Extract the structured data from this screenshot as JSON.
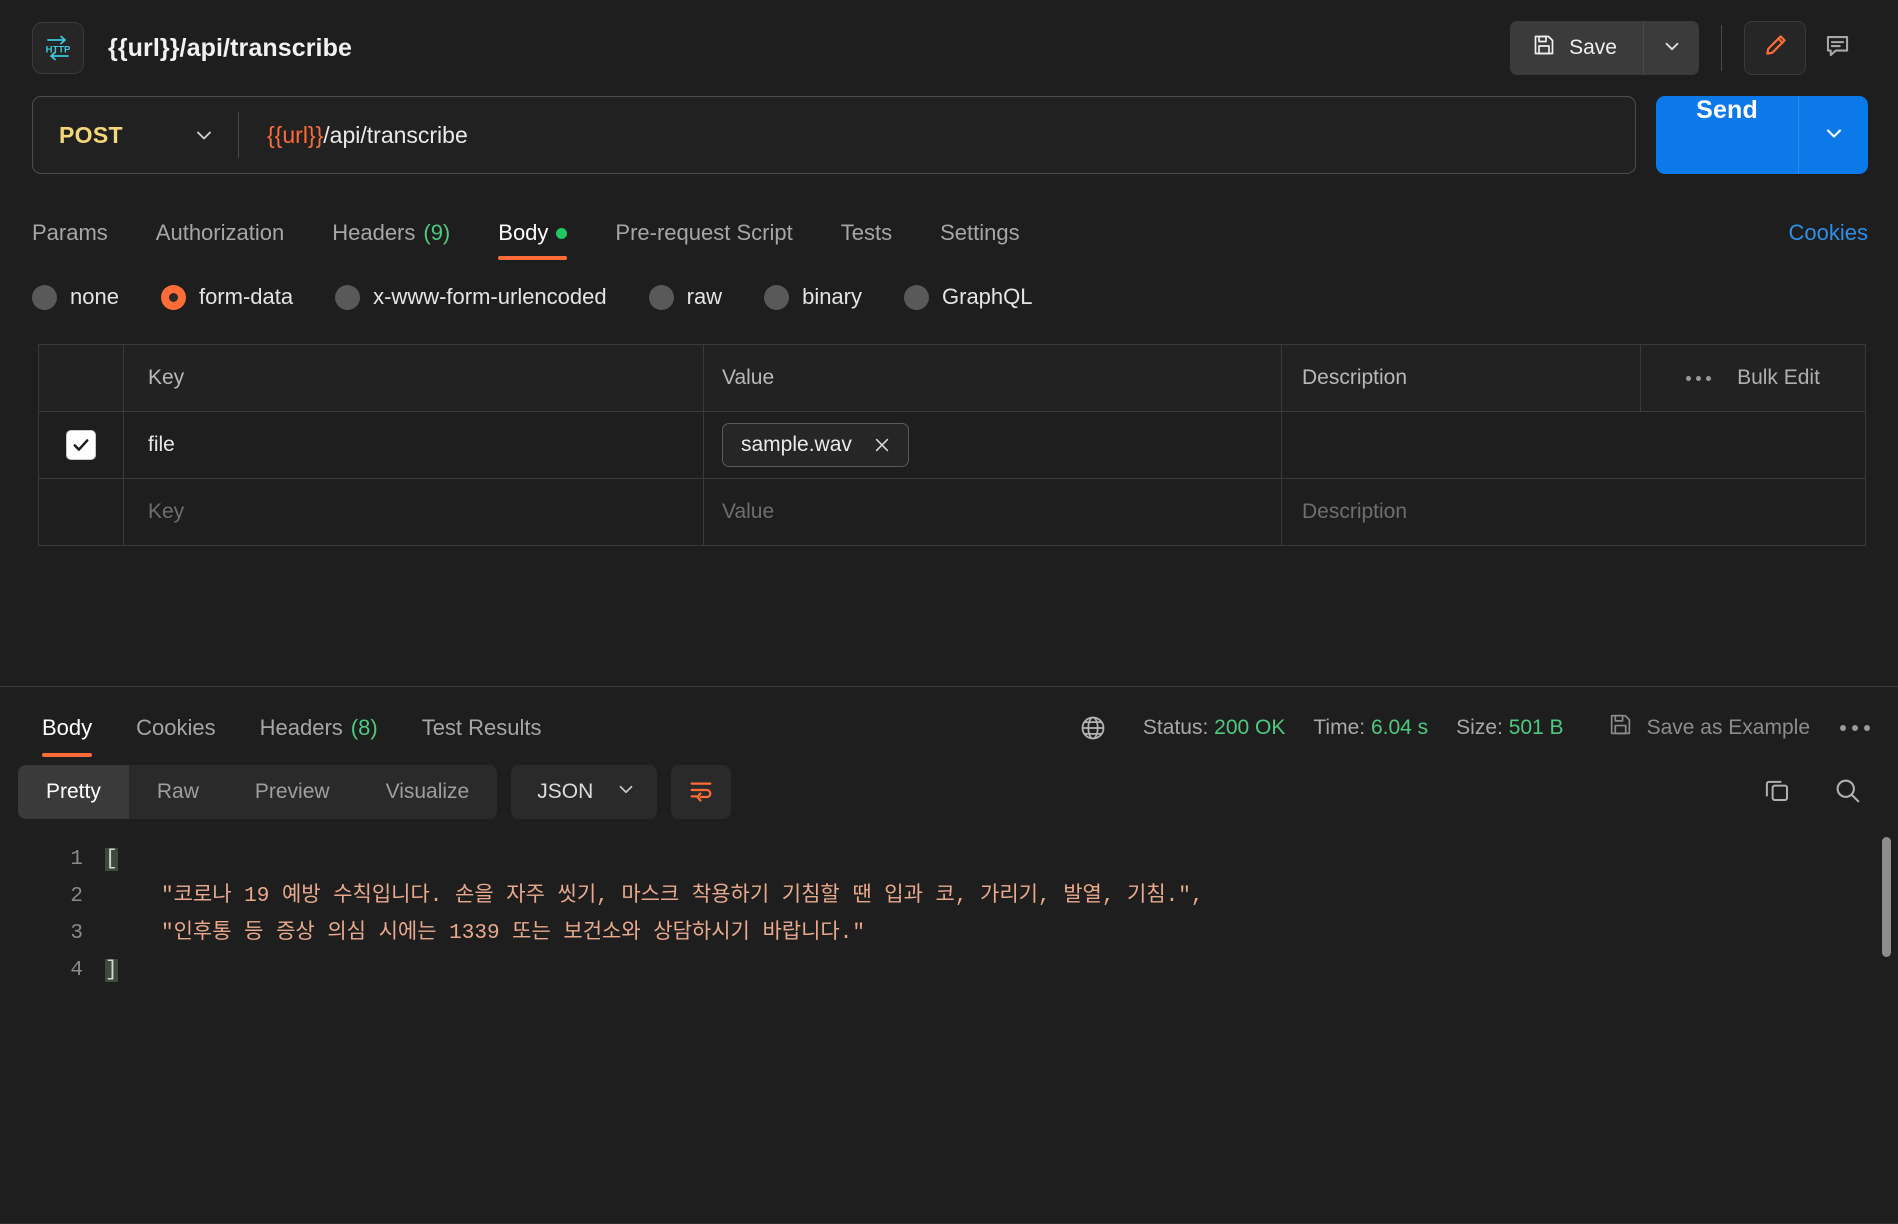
{
  "titlebar": {
    "badge_icon": "http-icon",
    "request_title": "{{url}}/api/transcribe",
    "save_label": "Save",
    "save_icon": "floppy-disk-icon",
    "save_caret_icon": "chevron-down-icon",
    "edit_icon": "pencil-icon",
    "comment_icon": "comment-icon"
  },
  "urlbar": {
    "method": "POST",
    "method_caret_icon": "chevron-down-icon",
    "url_var": "{{url}}",
    "url_path": "/api/transcribe",
    "url_full": "{{url}}/api/transcribe",
    "send_label": "Send",
    "send_caret_icon": "chevron-down-icon"
  },
  "request_tabs": {
    "items": [
      {
        "label": "Params",
        "active": false,
        "count": "",
        "dot": false
      },
      {
        "label": "Authorization",
        "active": false,
        "count": "",
        "dot": false
      },
      {
        "label": "Headers",
        "active": false,
        "count": "(9)",
        "dot": false
      },
      {
        "label": "Body",
        "active": true,
        "count": "",
        "dot": true
      },
      {
        "label": "Pre-request Script",
        "active": false,
        "count": "",
        "dot": false
      },
      {
        "label": "Tests",
        "active": false,
        "count": "",
        "dot": false
      },
      {
        "label": "Settings",
        "active": false,
        "count": "",
        "dot": false
      }
    ],
    "cookies_link": "Cookies"
  },
  "body_types": {
    "options": [
      {
        "label": "none",
        "selected": false
      },
      {
        "label": "form-data",
        "selected": true
      },
      {
        "label": "x-www-form-urlencoded",
        "selected": false
      },
      {
        "label": "raw",
        "selected": false
      },
      {
        "label": "binary",
        "selected": false
      },
      {
        "label": "GraphQL",
        "selected": false
      }
    ]
  },
  "kv_table": {
    "headers": {
      "key": "Key",
      "value": "Value",
      "description": "Description",
      "bulk_edit": "Bulk Edit"
    },
    "rows": [
      {
        "checked": true,
        "key": "file",
        "value": "sample.wav",
        "value_is_file": true,
        "description": ""
      }
    ],
    "placeholder_row": {
      "key": "Key",
      "value": "Value",
      "description": "Description"
    }
  },
  "response": {
    "tabs": [
      {
        "label": "Body",
        "active": true,
        "count": ""
      },
      {
        "label": "Cookies",
        "active": false,
        "count": ""
      },
      {
        "label": "Headers",
        "active": false,
        "count": "(8)"
      },
      {
        "label": "Test Results",
        "active": false,
        "count": ""
      }
    ],
    "globe_icon": "globe-icon",
    "status_label": "Status:",
    "status_value": "200 OK",
    "time_label": "Time:",
    "time_value": "6.04 s",
    "size_label": "Size:",
    "size_value": "501 B",
    "save_example_label": "Save as Example",
    "save_example_icon": "floppy-disk-icon",
    "more_icon": "ellipsis-icon",
    "viewer": {
      "modes": [
        {
          "label": "Pretty",
          "active": true
        },
        {
          "label": "Raw",
          "active": false
        },
        {
          "label": "Preview",
          "active": false
        },
        {
          "label": "Visualize",
          "active": false
        }
      ],
      "format": "JSON",
      "format_caret_icon": "chevron-down-icon",
      "wrap_icon": "word-wrap-icon",
      "copy_icon": "copy-icon",
      "search_icon": "search-icon"
    },
    "code": {
      "line_numbers": [
        "1",
        "2",
        "3",
        "4"
      ],
      "lines": [
        {
          "n": "1",
          "indent": 0,
          "text": "[",
          "bracket": true
        },
        {
          "n": "2",
          "indent": 1,
          "text": "\"코로나 19 예방 수칙입니다. 손을 자주 씻기, 마스크 착용하기 기침할 땐 입과 코, 가리기, 발열, 기침.\",",
          "bracket": false
        },
        {
          "n": "3",
          "indent": 1,
          "text": "\"인후통 등 증상 의심 시에는 1339 또는 보건소와 상담하시기 바랍니다.\"",
          "bracket": false
        },
        {
          "n": "4",
          "indent": 0,
          "text": "]",
          "bracket": true
        }
      ]
    }
  },
  "colors": {
    "accent_orange": "#ff6c37",
    "send_blue": "#0b79e8",
    "status_green": "#4ec97e",
    "method_yellow": "#f3d77a",
    "string_salmon": "#e8a98d",
    "link_blue": "#2e8fe8"
  }
}
